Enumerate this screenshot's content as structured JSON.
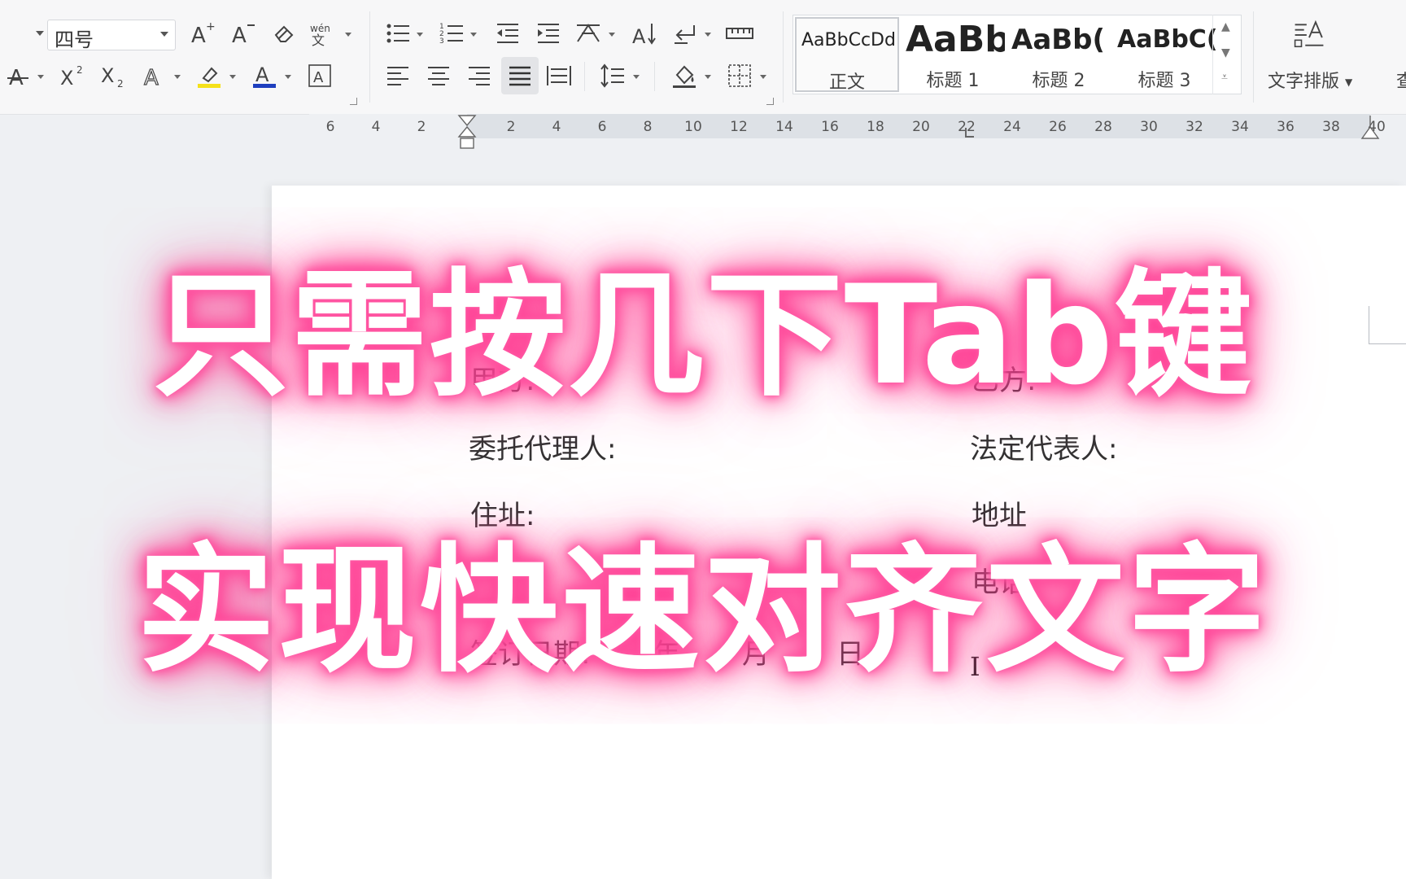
{
  "toolbar": {
    "font_size": "四号",
    "styles": [
      {
        "sample": "AaBbCcDd",
        "label": "正文",
        "selected": true
      },
      {
        "sample": "AaBb",
        "label": "标题 1",
        "selected": false
      },
      {
        "sample": "AaBb(",
        "label": "标题 2",
        "selected": false
      },
      {
        "sample": "AaBbC(",
        "label": "标题 3",
        "selected": false
      }
    ],
    "text_layout_label": "文字排版",
    "edge_partial": "查"
  },
  "ruler": {
    "left_numbers": [
      "6",
      "4",
      "2"
    ],
    "right_numbers": [
      "2",
      "4",
      "6",
      "8",
      "10",
      "12",
      "14",
      "16",
      "18",
      "20",
      "22",
      "24",
      "26",
      "28",
      "30",
      "32",
      "34",
      "36",
      "38",
      "40"
    ]
  },
  "document": {
    "party_a": "甲方:",
    "party_b": "乙方:",
    "agent": "委托代理人:",
    "legal_rep": "法定代表人:",
    "residence": "住址:",
    "address": "地址",
    "phone": "电话",
    "sign_date": "签订日期:",
    "year": "年",
    "month": "月",
    "day": "日"
  },
  "overlay": {
    "line1": "只需按几下Tab键",
    "line2": "实现快速对齐文字"
  },
  "colors": {
    "glow": "#ff3c92",
    "active_button": "#e3e4e7",
    "font_color_bar": "#1f3fbf",
    "highlight_bar": "#f5e11a"
  }
}
